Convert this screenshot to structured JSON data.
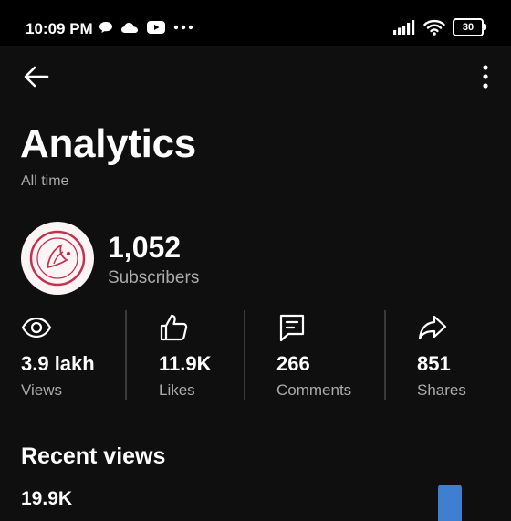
{
  "status_bar": {
    "time": "10:09 PM",
    "battery": "30",
    "icons_left": [
      "chat-bubble-icon",
      "cloud-icon",
      "youtube-icon",
      "more-dots-icon"
    ],
    "icons_right": [
      "signal-icon",
      "wifi-icon",
      "battery-icon"
    ]
  },
  "header": {
    "back_icon": "arrow-left-icon",
    "menu_icon": "more-vertical-icon"
  },
  "page": {
    "title": "Analytics",
    "subtitle": "All time"
  },
  "channel": {
    "subscribers_count": "1,052",
    "subscribers_label": "Subscribers"
  },
  "stats": [
    {
      "icon": "eye-icon",
      "value": "3.9 lakh",
      "label": "Views"
    },
    {
      "icon": "thumbs-up-icon",
      "value": "11.9K",
      "label": "Likes"
    },
    {
      "icon": "comment-icon",
      "value": "266",
      "label": "Comments"
    },
    {
      "icon": "share-icon",
      "value": "851",
      "label": "Shares"
    }
  ],
  "recent_views": {
    "title": "Recent views",
    "value": "19.9K"
  },
  "colors": {
    "background": "#0f0f0f",
    "text_primary": "#f1f1f1",
    "text_secondary": "#aaaaaa",
    "divider": "#3a3a3a",
    "chart_bar": "#3e7fd1",
    "avatar_bg": "#fdf4f5",
    "avatar_accent": "#c2334d"
  }
}
